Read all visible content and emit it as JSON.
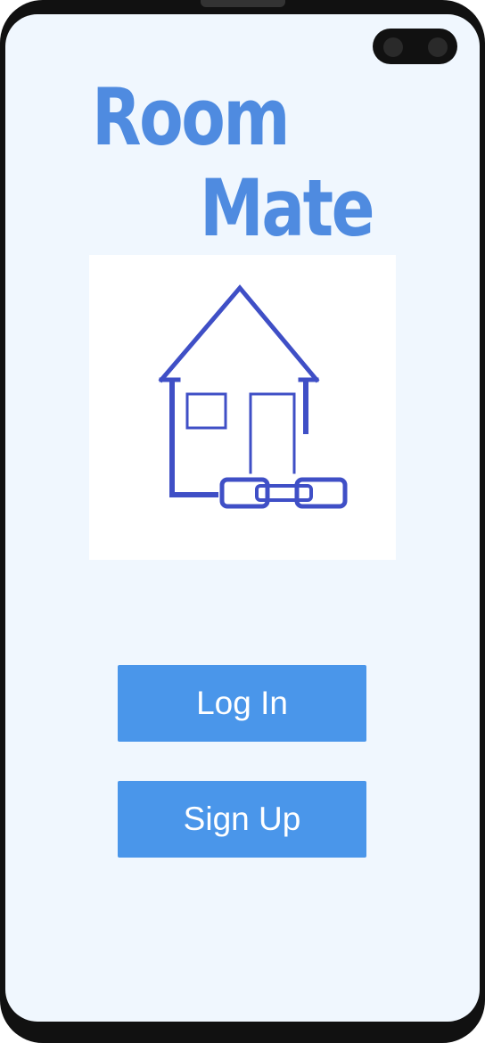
{
  "app": {
    "title_line1": "Room",
    "title_line2": "Mate",
    "logo": "house-chain-logo"
  },
  "actions": {
    "login_label": "Log In",
    "signup_label": "Sign Up"
  },
  "colors": {
    "accent": "#4a96ea",
    "title": "#4f8be0",
    "logo_stroke": "#3f4fc6",
    "background": "#f0f7fe"
  }
}
